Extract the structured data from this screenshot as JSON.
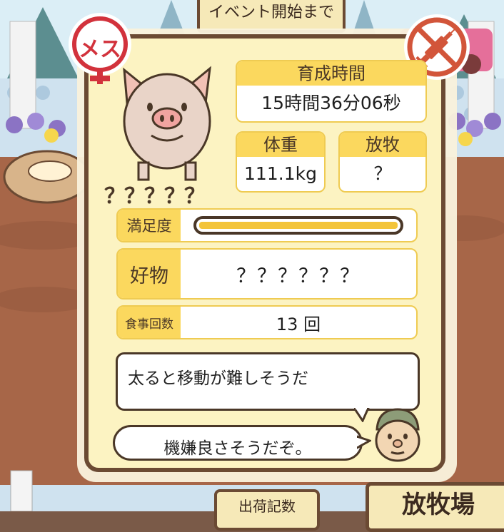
{
  "background": {
    "event_banner": "イベント開始まで",
    "ranch_sign": "放牧場",
    "bottom_sign": "出荷記数"
  },
  "pig": {
    "name": "？？？？？",
    "gender_badge": "メス",
    "gender_icon": "female-icon",
    "status_icon": "no-injection-icon"
  },
  "stats": {
    "growth_label": "育成時間",
    "growth_value": "15時間36分06秒",
    "weight_label": "体重",
    "weight_value": "111.1kg",
    "grazing_label": "放牧",
    "grazing_value": "？"
  },
  "satisfaction": {
    "label": "満足度",
    "level": 1.0
  },
  "favorite": {
    "label": "好物",
    "value": "？？？？？？"
  },
  "meals": {
    "label": "食事回数",
    "value": "13 回"
  },
  "messages": {
    "comment": "太ると移動が難しそうだ",
    "farmer_says": "機嫌良さそうだぞ。"
  },
  "colors": {
    "accent_yellow": "#fbd85e",
    "border_brown": "#6b4a33",
    "panel_cream": "#fcf3c2",
    "badge_red": "#d2323c",
    "badge_orange": "#d2553a"
  }
}
